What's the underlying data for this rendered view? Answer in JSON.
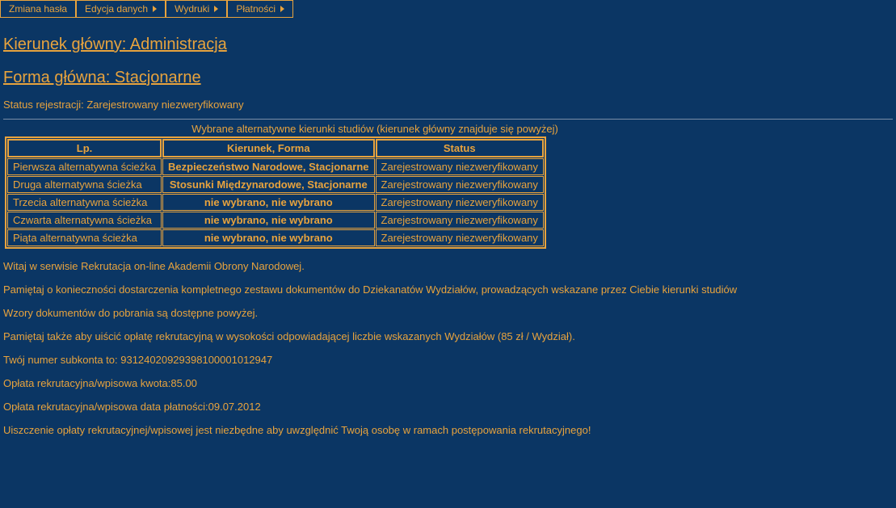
{
  "menu": {
    "items": [
      {
        "label": "Zmiana hasła",
        "hasArrow": false
      },
      {
        "label": "Edycja danych",
        "hasArrow": true
      },
      {
        "label": "Wydruki",
        "hasArrow": true
      },
      {
        "label": "Płatności",
        "hasArrow": true
      }
    ]
  },
  "headings": {
    "kierunek": "Kierunek główny: Administracja",
    "forma": "Forma główna: Stacjonarne"
  },
  "status_line": "Status rejestracji: Zarejestrowany niezweryfikowany",
  "table": {
    "caption": "Wybrane alternatywne kierunki studiów (kierunek główny znajduje się powyżej)",
    "headers": {
      "lp": "Lp.",
      "kierunek": "Kierunek, Forma",
      "status": "Status"
    },
    "rows": [
      {
        "lp": "Pierwsza alternatywna ścieżka",
        "kf": "Bezpieczeństwo Narodowe, Stacjonarne",
        "st": "Zarejestrowany niezweryfikowany"
      },
      {
        "lp": "Druga alternatywna ścieżka",
        "kf": "Stosunki Międzynarodowe, Stacjonarne",
        "st": "Zarejestrowany niezweryfikowany"
      },
      {
        "lp": "Trzecia alternatywna ścieżka",
        "kf": "nie wybrano, nie wybrano",
        "st": "Zarejestrowany niezweryfikowany"
      },
      {
        "lp": "Czwarta alternatywna ścieżka",
        "kf": "nie wybrano, nie wybrano",
        "st": "Zarejestrowany niezweryfikowany"
      },
      {
        "lp": "Piąta alternatywna ścieżka",
        "kf": "nie wybrano, nie wybrano",
        "st": "Zarejestrowany niezweryfikowany"
      }
    ]
  },
  "paragraphs": {
    "p1": "Witaj w serwisie Rekrutacja on-line Akademii Obrony Narodowej.",
    "p2": "Pamiętaj o konieczności dostarczenia kompletnego zestawu dokumentów do Dziekanatów Wydziałów, prowadzących wskazane przez Ciebie kierunki studiów",
    "p3": "Wzory dokumentów do pobrania są dostępne powyżej.",
    "p4": "Pamiętaj także aby uiścić opłatę rekrutacyjną w wysokości odpowiadającej liczbie wskazanych Wydziałów (85 zł / Wydział).",
    "p5": "Twój numer subkonta to: 93124020929398100001012947",
    "p6": "Opłata rekrutacyjna/wpisowa kwota:85.00",
    "p7": "Opłata rekrutacyjna/wpisowa data płatności:09.07.2012",
    "p8": "Uiszczenie opłaty rekrutacyjnej/wpisowej jest niezbędne aby uwzględnić Twoją osobę w ramach postępowania rekrutacyjnego!"
  }
}
